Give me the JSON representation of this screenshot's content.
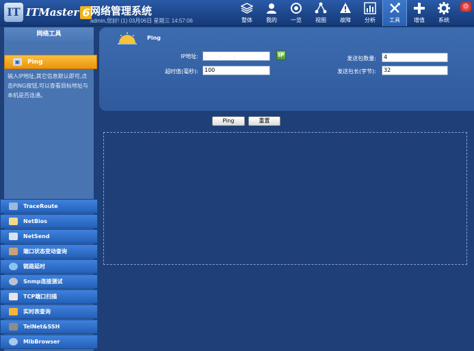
{
  "header": {
    "logo_text": "ITMaster",
    "logo_version": "6",
    "app_title": "网络管理系统",
    "user_line": "admin,您好! (1) 03月06日 星期三 14:57:06",
    "nav": [
      {
        "label": "整体",
        "icon": "layers-icon"
      },
      {
        "label": "我的",
        "icon": "user-icon"
      },
      {
        "label": "一览",
        "icon": "overview-icon"
      },
      {
        "label": "视图",
        "icon": "topology-icon"
      },
      {
        "label": "故障",
        "icon": "warning-icon"
      },
      {
        "label": "分析",
        "icon": "chart-icon"
      },
      {
        "label": "工具",
        "icon": "tools-icon"
      },
      {
        "label": "增值",
        "icon": "plus-icon"
      },
      {
        "label": "系统",
        "icon": "gear-icon"
      }
    ]
  },
  "sidebar": {
    "title": "网络工具",
    "active_tool": "Ping",
    "description": "输入IP地址,其它信息默认即可,点击PING按钮,可以查看目标地址与本机是否连通。",
    "tools": [
      {
        "label": "TraceRoute",
        "icon": "traceroute-icon",
        "color": "#9bb8de"
      },
      {
        "label": "NetBios",
        "icon": "netbios-icon",
        "color": "#f5d98a"
      },
      {
        "label": "NetSend",
        "icon": "netsend-icon",
        "color": "#d7e2ef"
      },
      {
        "label": "端口状态变动查询",
        "icon": "port-status-icon",
        "color": "#c7a27b"
      },
      {
        "label": "链路延时",
        "icon": "link-delay-icon",
        "color": "#8fc1ef"
      },
      {
        "label": "Snmp连接测试",
        "icon": "snmp-icon",
        "color": "#b9c4cf"
      },
      {
        "label": "TCP端口扫描",
        "icon": "tcp-scan-icon",
        "color": "#e6e6e6"
      },
      {
        "label": "实时表查询",
        "icon": "realtime-table-icon",
        "color": "#f2b63a"
      },
      {
        "label": "TelNet&SSH",
        "icon": "telnet-icon",
        "color": "#8c8c8c"
      },
      {
        "label": "MibBrowser",
        "icon": "mib-icon",
        "color": "#a9c8ef"
      }
    ]
  },
  "form": {
    "heading": "Ping",
    "ip_label": "IP地址:",
    "ip_value": ". . .",
    "ip_button": "IP",
    "timeout_label": "超时值(毫秒):",
    "timeout_value": "100",
    "count_label": "发送包数量:",
    "count_value": "4",
    "size_label": "发送包长(字节):",
    "size_value": "32"
  },
  "actions": {
    "ping": "Ping",
    "reset": "重置"
  }
}
